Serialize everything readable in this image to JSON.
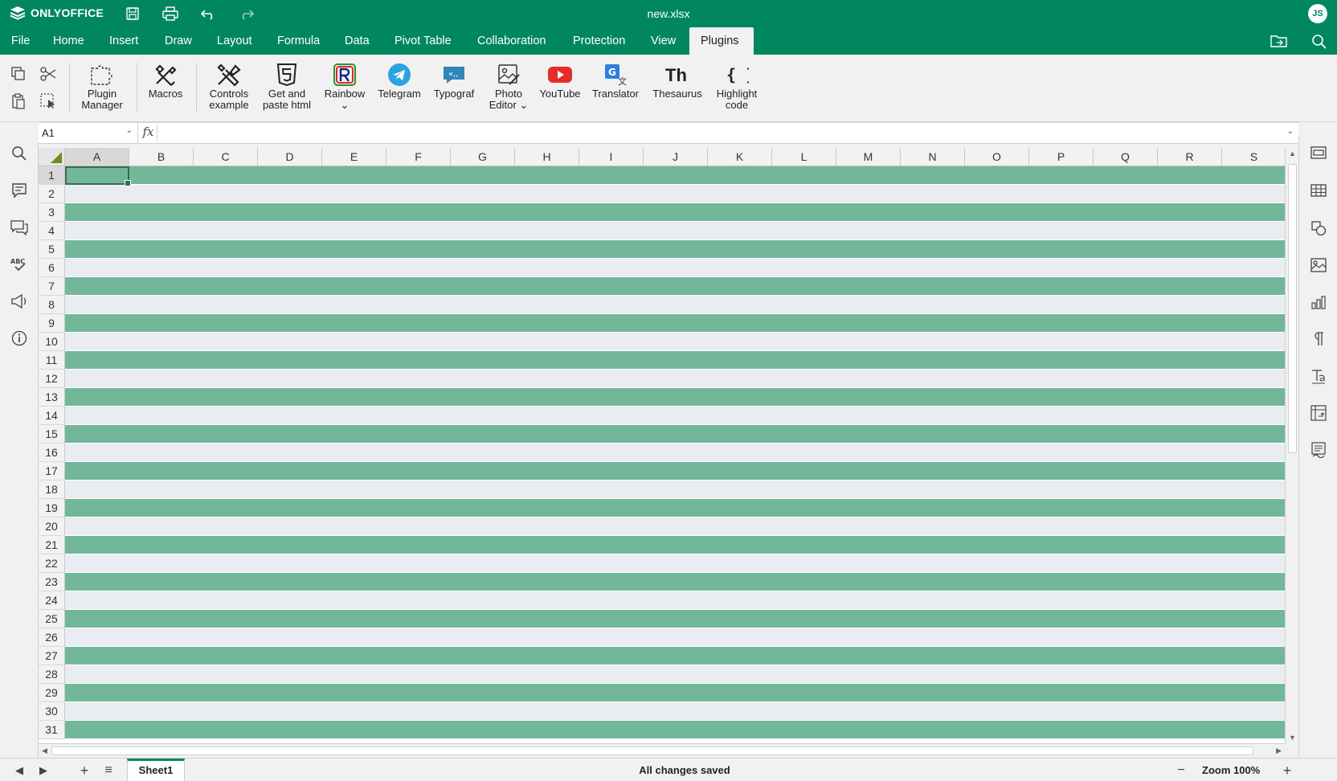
{
  "app": {
    "brand": "ONLYOFFICE",
    "document_title": "new.xlsx",
    "user_initials": "JS"
  },
  "colors": {
    "brand": "#00875f",
    "band": "#72b79a",
    "band_alt": "#e9edf2"
  },
  "title_icons": [
    "save-icon",
    "print-icon",
    "undo-icon",
    "redo-icon"
  ],
  "menu": {
    "items": [
      "File",
      "Home",
      "Insert",
      "Draw",
      "Layout",
      "Formula",
      "Data",
      "Pivot Table",
      "Collaboration",
      "Protection",
      "View",
      "Plugins"
    ],
    "active": "Plugins"
  },
  "ribbon": {
    "plugins": [
      {
        "label": "Plugin\nManager",
        "icon": "plugin-manager-icon"
      },
      {
        "label": "Macros",
        "icon": "macros-icon"
      },
      {
        "label": "Controls\nexample",
        "icon": "controls-example-icon"
      },
      {
        "label": "Get and\npaste html",
        "icon": "html5-icon"
      },
      {
        "label": "Rainbow\n⌄",
        "icon": "rainbow-icon"
      },
      {
        "label": "Telegram",
        "icon": "telegram-icon"
      },
      {
        "label": "Typograf",
        "icon": "typograf-icon"
      },
      {
        "label": "Photo\nEditor ⌄",
        "icon": "photo-editor-icon"
      },
      {
        "label": "YouTube",
        "icon": "youtube-icon"
      },
      {
        "label": "Translator",
        "icon": "translator-icon"
      },
      {
        "label": "Thesaurus",
        "icon": "thesaurus-icon"
      },
      {
        "label": "Highlight\ncode",
        "icon": "highlight-code-icon"
      }
    ]
  },
  "formula_bar": {
    "cell_ref": "A1",
    "fx_label": "fx",
    "value": ""
  },
  "grid": {
    "columns": [
      "A",
      "B",
      "C",
      "D",
      "E",
      "F",
      "G",
      "H",
      "I",
      "J",
      "K",
      "L",
      "M",
      "N",
      "O",
      "P",
      "Q",
      "R",
      "S"
    ],
    "rows": [
      "1",
      "2",
      "3",
      "4",
      "5",
      "6",
      "7",
      "8",
      "9",
      "10",
      "11",
      "12",
      "13",
      "14",
      "15",
      "16",
      "17",
      "18",
      "19",
      "20",
      "21",
      "22",
      "23",
      "24",
      "25",
      "26",
      "27",
      "28",
      "29",
      "30",
      "31"
    ],
    "selected_cell": "A1"
  },
  "left_sidebar": [
    "search-icon",
    "comments-icon",
    "chat-icon",
    "spellcheck-icon",
    "feedback-icon",
    "about-icon"
  ],
  "right_sidebar": [
    "cell-settings-icon",
    "table-settings-icon",
    "shape-settings-icon",
    "image-settings-icon",
    "chart-settings-icon",
    "paragraph-settings-icon",
    "text-art-icon",
    "pivot-settings-icon",
    "signature-icon"
  ],
  "status_bar": {
    "sheet_name": "Sheet1",
    "save_status": "All changes saved",
    "zoom_label": "Zoom 100%"
  }
}
